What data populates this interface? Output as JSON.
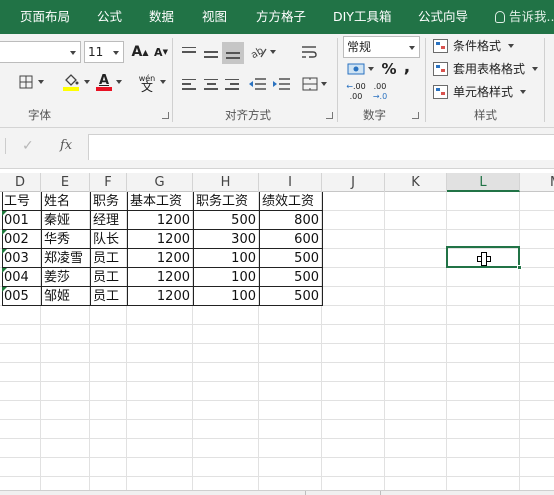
{
  "ribbon_tabs": [
    "页面布局",
    "公式",
    "数据",
    "视图",
    "方方格子",
    "DIY工具箱",
    "公式向导"
  ],
  "tell_me": "告诉我...",
  "font": {
    "group_label": "字体",
    "size": "11",
    "grow_label": "A",
    "shrink_label": "A",
    "font_color_label": "A",
    "phonetic_label": "wén",
    "phonetic_char": "文"
  },
  "alignment": {
    "group_label": "对齐方式"
  },
  "number": {
    "group_label": "数字",
    "format": "常规",
    "percent": "%",
    "comma": ",",
    "inc_decimal": ".00",
    "dec_decimal": ".00"
  },
  "styles": {
    "group_label": "样式",
    "conditional_formatting": "条件格式",
    "format_as_table": "套用表格格式",
    "cell_styles": "单元格样式"
  },
  "formula_bar": {
    "fx": "fx",
    "value": ""
  },
  "columns": [
    "D",
    "E",
    "F",
    "G",
    "H",
    "I",
    "J",
    "K",
    "L",
    "M"
  ],
  "selected_column": "L",
  "table": {
    "headers": [
      "工号",
      "姓名",
      "职务",
      "基本工资",
      "职务工资",
      "绩效工资"
    ],
    "rows": [
      [
        "001",
        "秦娅",
        "经理",
        "1200",
        "500",
        "800"
      ],
      [
        "002",
        "华秀",
        "队长",
        "1200",
        "300",
        "600"
      ],
      [
        "003",
        "郑凌雪",
        "员工",
        "1200",
        "100",
        "500"
      ],
      [
        "004",
        "姜莎",
        "员工",
        "1200",
        "100",
        "500"
      ],
      [
        "005",
        "邹姬",
        "员工",
        "1200",
        "100",
        "500"
      ]
    ]
  },
  "colors": {
    "brand": "#217346",
    "font_color": "#e81123",
    "fill_color": "#ffff00"
  }
}
